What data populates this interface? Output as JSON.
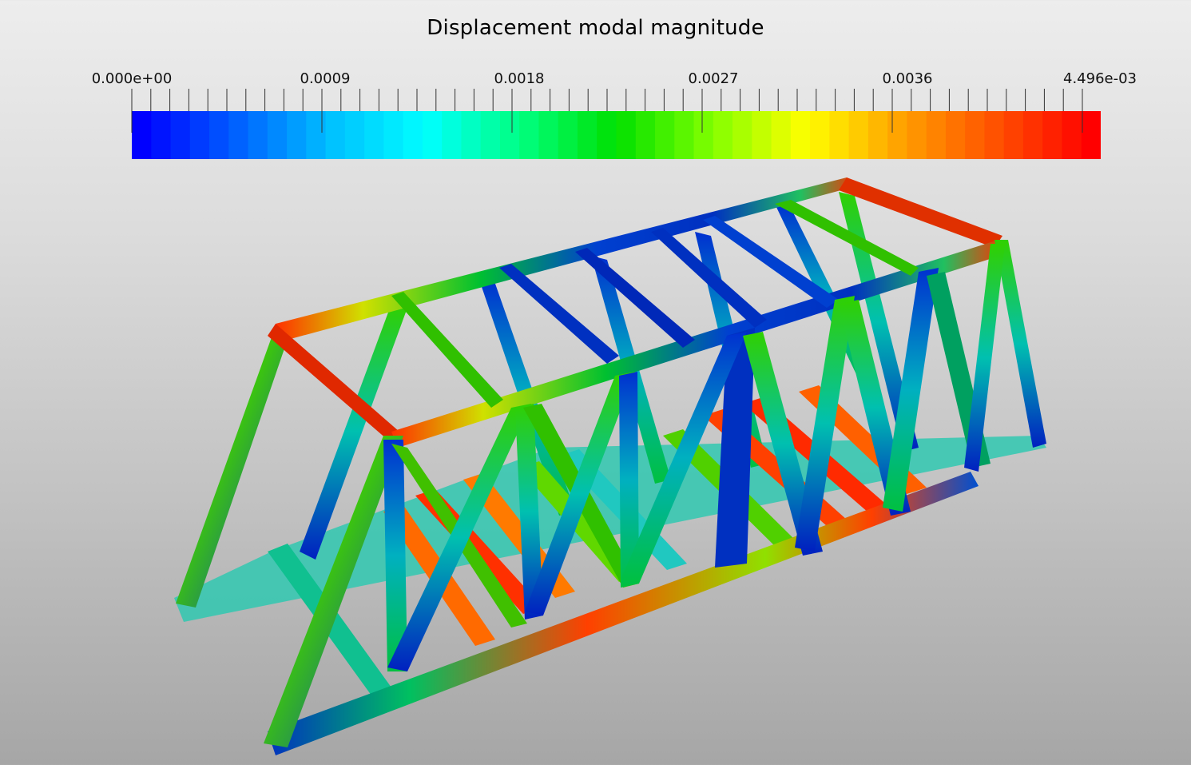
{
  "title": "Displacement modal magnitude",
  "legend": {
    "tick_labels": [
      "0.000e+00",
      "0.0009",
      "0.0018",
      "0.0027",
      "0.0036",
      "4.496e-03"
    ],
    "range": [
      0,
      0.004496
    ],
    "colormap": [
      "#0000ff",
      "#0060ff",
      "#00c0ff",
      "#00ffff",
      "#00ff80",
      "#00e000",
      "#80ff00",
      "#ffff00",
      "#ffa000",
      "#ff5000",
      "#ff0000"
    ]
  }
}
